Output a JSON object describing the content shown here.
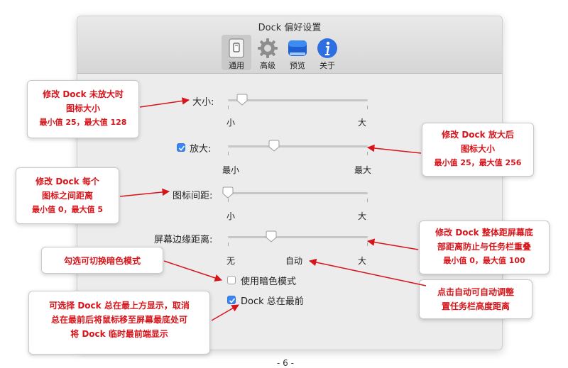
{
  "window": {
    "title": "Dock 偏好设置",
    "toolbar": [
      {
        "label": "通用",
        "icon": "general-switch-icon",
        "active": true
      },
      {
        "label": "高级",
        "icon": "gear-icon",
        "active": false
      },
      {
        "label": "预览",
        "icon": "preview-window-icon",
        "active": false
      },
      {
        "label": "关于",
        "icon": "info-icon",
        "active": false
      }
    ]
  },
  "settings": {
    "size": {
      "label": "大小:",
      "min_label": "小",
      "max_label": "大",
      "value": 0.1
    },
    "magnify": {
      "label": "放大:",
      "checked": true,
      "min_label": "最小",
      "max_label": "最大",
      "value": 0.33
    },
    "spacing": {
      "label": "图标间距:",
      "min_label": "小",
      "max_label": "大",
      "value": 0.0
    },
    "edge": {
      "label": "屏幕边缘距离:",
      "min_label": "无",
      "mid_label": "自动",
      "max_label": "大",
      "value": 0.31
    },
    "dark_mode": {
      "label": "使用暗色模式",
      "checked": false
    },
    "always_top": {
      "label": "Dock 总在最前",
      "checked": true
    }
  },
  "callouts": {
    "size": [
      "修改 Dock 未放大时",
      "图标大小",
      "最小值 25，最大值 128"
    ],
    "magnify": [
      "修改 Dock 放大后",
      "图标大小",
      "最小值 25，最大值 256"
    ],
    "spacing": [
      "修改 Dock 每个",
      "图标之间距离",
      "最小值 0，最大值 5"
    ],
    "edge": [
      "修改 Dock 整体距屏幕底",
      "部距离防止与任务栏重叠",
      "最小值 0，最大值 100"
    ],
    "dark": [
      "勾选可切换暗色模式"
    ],
    "auto": [
      "点击自动可自动调整",
      "置任务栏高度距离"
    ],
    "top": [
      "可选择 Dock 总在最上方显示，取消",
      "总在最前后将鼠标移至屏幕最底处可",
      "将 Dock 临时最前端显示"
    ]
  },
  "page_number": "- 6 -",
  "colors": {
    "callout_text": "#d6141a",
    "arrow": "#d6141a",
    "checkbox_accent": "#3a86f2"
  }
}
